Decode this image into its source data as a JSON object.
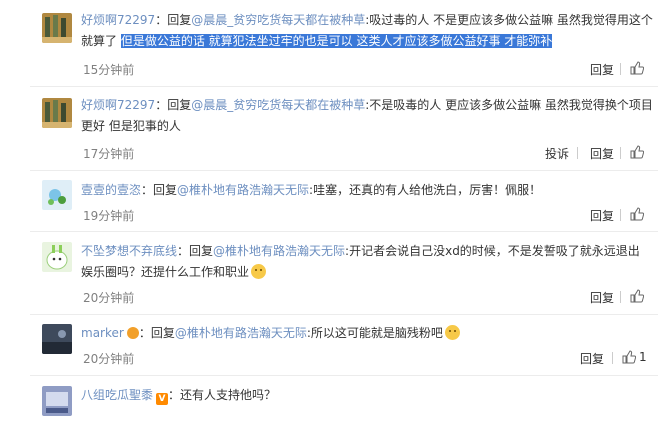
{
  "colors": {
    "link": "#6d8fc0",
    "selection": "#3a78d8",
    "time": "#808080",
    "badge_orange": "#ff8a00"
  },
  "labels": {
    "reply": "回复",
    "report": "投诉"
  },
  "comments": [
    {
      "user": "好烦啊72297",
      "lines": [
        [
          "：回复",
          "@晨晨_贫穷吃货每天都在被种草",
          ":吸过毒的人 不是更应该多做公益嘛 虽然我觉得用这个"
        ],
        [
          "就算了 ",
          "但是做公益的话 就算犯法坐过牢的也是可以 这类人才应该多做公益好事 才能弥补",
          ""
        ]
      ],
      "time": "15分钟前"
    },
    {
      "user": "好烦啊72297",
      "lines": [
        [
          "：回复",
          "@晨晨_贫穷吃货每天都在被种草",
          ":不是吸毒的人 更应该多做公益嘛 虽然我觉得换个项目"
        ],
        [
          "更好 但是犯事的人",
          "",
          ""
        ]
      ],
      "time": "17分钟前"
    },
    {
      "user": "壹壹的壹恣",
      "lines": [
        [
          "：回复",
          "@椎朴地有路浩瀚天无际",
          ":哇塞，还真的有人给他洗白，厉害！佩服！"
        ]
      ],
      "time": "19分钟前"
    },
    {
      "user": "不坠梦想不弃底线",
      "lines": [
        [
          "：回复",
          "@椎朴地有路浩瀚天无际",
          ":开记者会说自己没xd的时候，不是发誓吸了就永远退出"
        ],
        [
          "娱乐圈吗？还提什么工作和职业",
          "",
          ""
        ]
      ],
      "time": "20分钟前"
    },
    {
      "user": "marker",
      "lines": [
        [
          "：回复",
          "@椎朴地有路浩瀚天无际",
          ":所以这可能就是脑残粉吧"
        ]
      ],
      "time": "20分钟前"
    },
    {
      "user": "八组吃瓜聖黍",
      "lines": [
        [
          "：还有人支持他吗？",
          "",
          ""
        ]
      ],
      "time": ""
    }
  ]
}
